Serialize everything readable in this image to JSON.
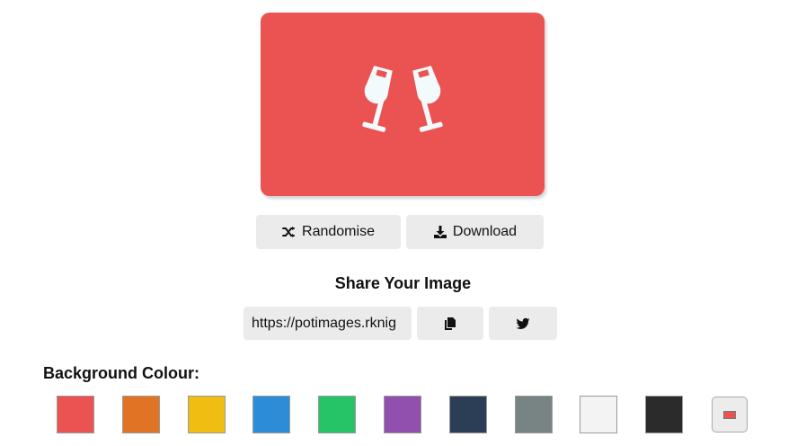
{
  "preview": {
    "background": "#EB5353",
    "icon": "glass-cheers-icon",
    "icon_color": "#F3FAFC"
  },
  "actions": {
    "randomise_label": "Randomise",
    "randomise_icon": "shuffle-icon",
    "download_label": "Download",
    "download_icon": "download-icon"
  },
  "share": {
    "title": "Share Your Image",
    "url": "https://potimages.rknig",
    "copy_icon": "copy-icon",
    "twitter_icon": "twitter-icon"
  },
  "background": {
    "label": "Background Colour:",
    "swatches": [
      "#EB5353",
      "#E07424",
      "#F0BE12",
      "#2D8CD8",
      "#27C467",
      "#914FAE",
      "#2C3E55",
      "#778483",
      "#F3F3F3",
      "#2B2B2B"
    ],
    "picker_value": "#EB5353"
  }
}
